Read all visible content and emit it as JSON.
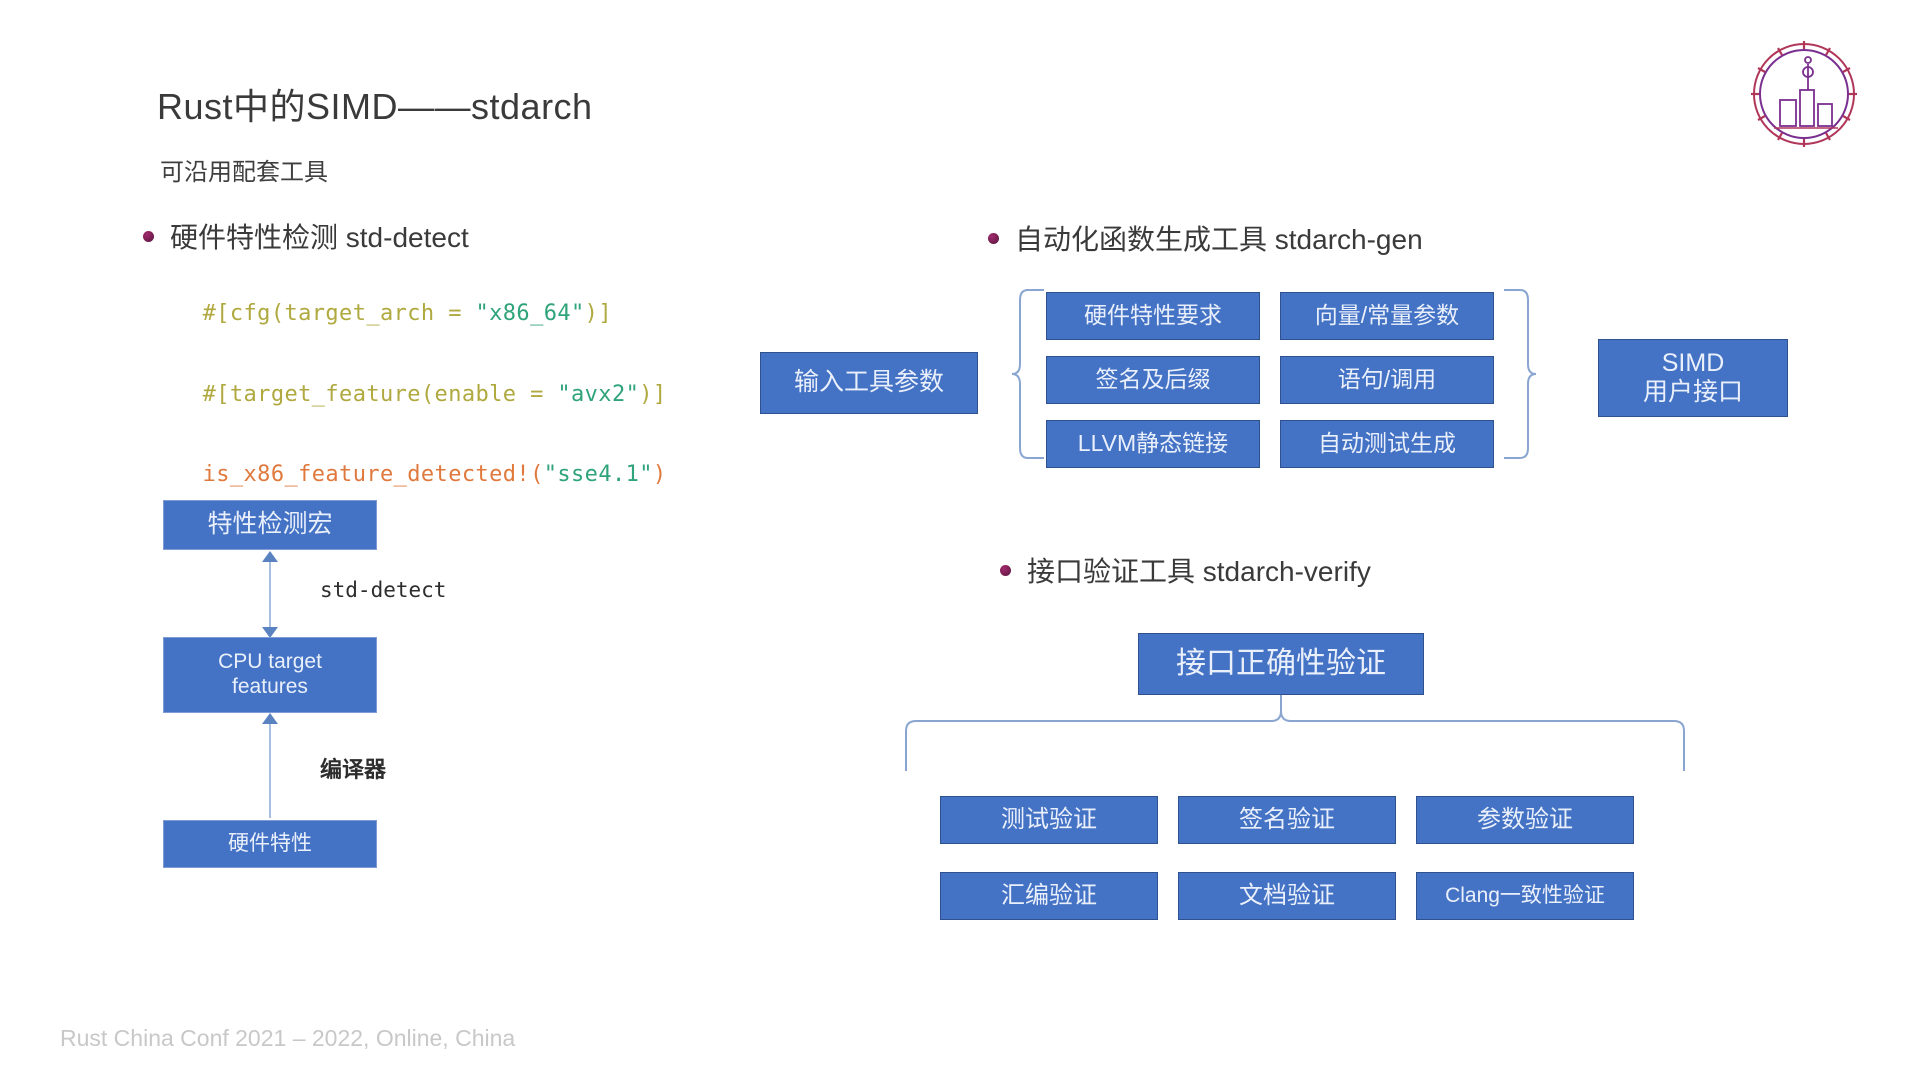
{
  "slide": {
    "title": "Rust中的SIMD——stdarch",
    "subtitle": "可沿用配套工具",
    "footer": "Rust China Conf 2021 – 2022, Online, China"
  },
  "sections": {
    "std_detect": {
      "heading": "硬件特性检测 std-detect",
      "code_lines": [
        {
          "prefix": "#[cfg(target_arch = ",
          "string": "\"x86_64\"",
          "suffix": ")]"
        },
        {
          "prefix": "#[target_feature(enable = ",
          "string": "\"avx2\"",
          "suffix": ")]"
        }
      ],
      "macro_line": {
        "macro": "is_x86_feature_detected!",
        "open": "(",
        "string": "\"sse4.1\"",
        "close": ")"
      },
      "flow": {
        "boxes": [
          {
            "label": "特性检测宏"
          },
          {
            "label": "CPU target\nfeatures",
            "line1": "CPU target",
            "line2": "features"
          },
          {
            "label": "硬件特性"
          }
        ],
        "connector_labels": [
          "std-detect",
          "编译器"
        ]
      }
    },
    "stdarch_gen": {
      "heading": "自动化函数生成工具 stdarch-gen",
      "input_box": "输入工具参数",
      "middle_boxes": [
        [
          "硬件特性要求",
          "向量/常量参数"
        ],
        [
          "签名及后缀",
          "语句/调用"
        ],
        [
          "LLVM静态链接",
          "自动测试生成"
        ]
      ],
      "output_box": {
        "line1": "SIMD",
        "line2": "用户接口"
      }
    },
    "stdarch_verify": {
      "heading": "接口验证工具 stdarch-verify",
      "root_box": "接口正确性验证",
      "leaf_boxes": [
        [
          "测试验证",
          "签名验证",
          "参数验证"
        ],
        [
          "汇编验证",
          "文档验证",
          "Clang一致性验证"
        ]
      ]
    }
  },
  "colors": {
    "box_fill": "#4472C4",
    "box_border": "#2F528F",
    "bullet": "#7B1F52",
    "code_attr": "#B0A93F",
    "code_string": "#2FA37A",
    "code_macro": "#E0793E",
    "footer_text": "#C8C8C8"
  },
  "logo": {
    "name": "rust-china-conf-logo"
  }
}
